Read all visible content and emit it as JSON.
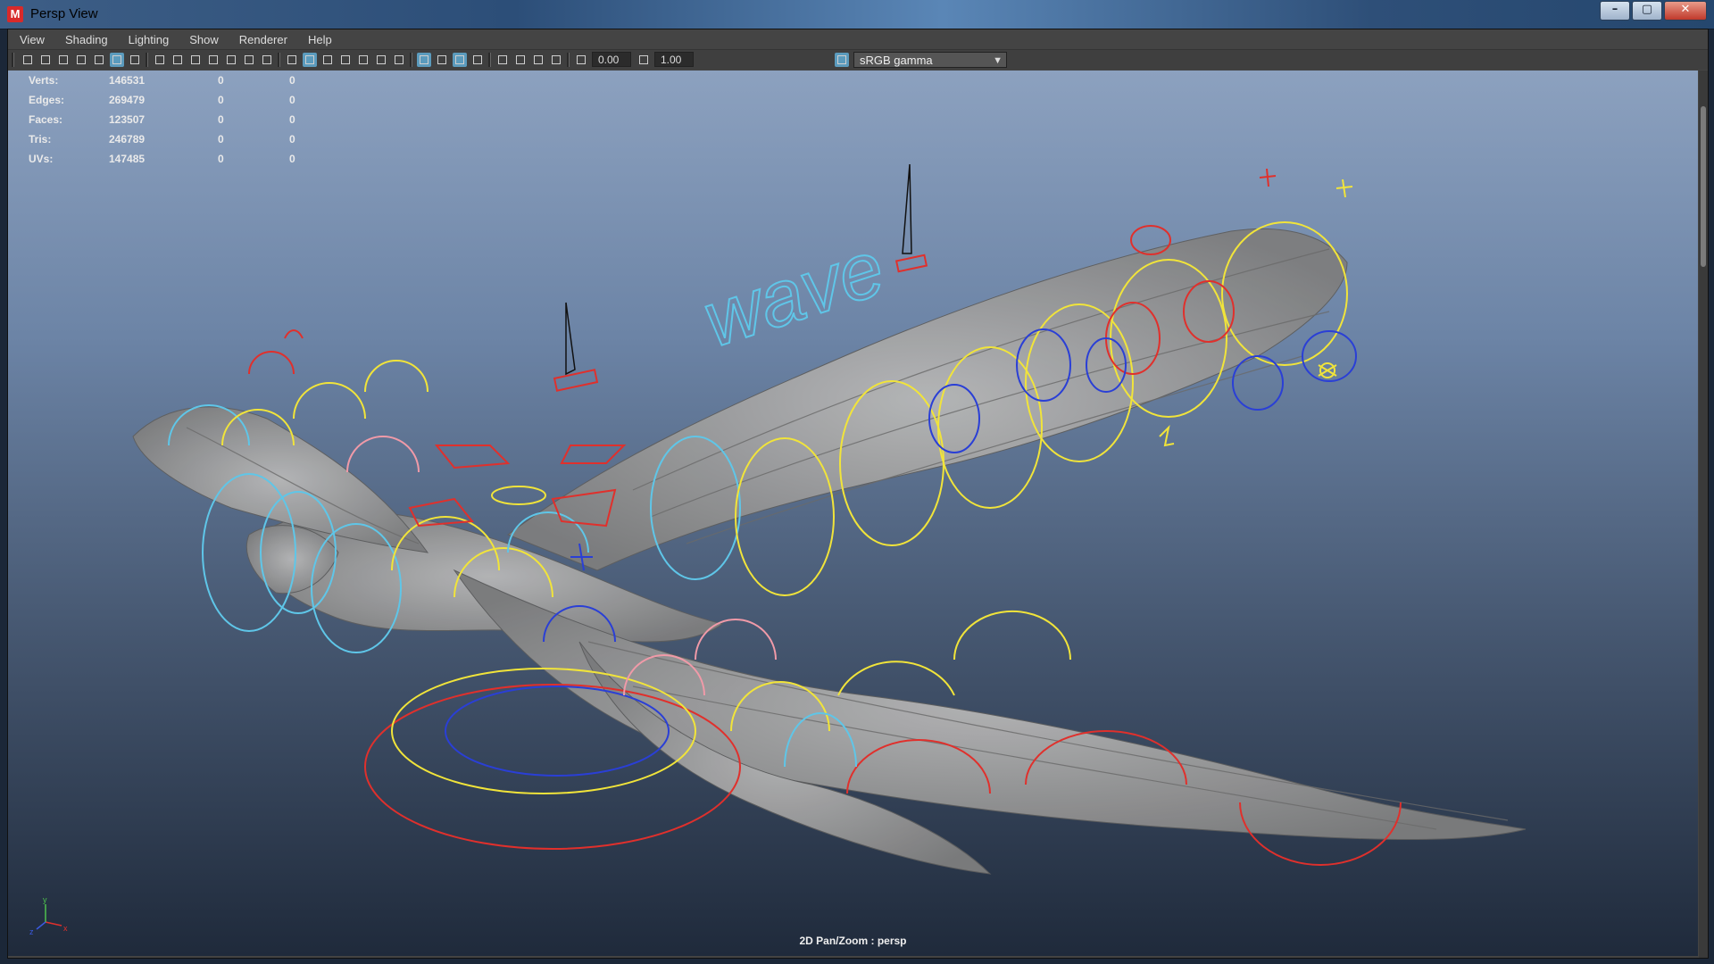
{
  "window": {
    "title": "Persp View",
    "app_icon_letter": "M",
    "controls": {
      "minimize": "–",
      "maximize": "▢",
      "close": "✕"
    }
  },
  "menu": {
    "items": [
      "View",
      "Shading",
      "Lighting",
      "Show",
      "Renderer",
      "Help"
    ]
  },
  "toolbar": {
    "exposure": "0.00",
    "gamma": "1.00",
    "color_space": "sRGB gamma",
    "active_color": "#5b9bbd"
  },
  "hud": {
    "rows": [
      {
        "label": "Verts:",
        "v1": "146531",
        "v2": "0",
        "v3": "0"
      },
      {
        "label": "Edges:",
        "v1": "269479",
        "v2": "0",
        "v3": "0"
      },
      {
        "label": "Faces:",
        "v1": "123507",
        "v2": "0",
        "v3": "0"
      },
      {
        "label": "Tris:",
        "v1": "246789",
        "v2": "0",
        "v3": "0"
      },
      {
        "label": "UVs:",
        "v1": "147485",
        "v2": "0",
        "v3": "0"
      }
    ]
  },
  "viewport": {
    "camera_label": "2D Pan/Zoom : persp",
    "control_text": "wave",
    "axis": {
      "x": "x",
      "y": "y",
      "z": "z"
    },
    "rig_colors": {
      "yellow": "#f1e43a",
      "cyan": "#5fc6e8",
      "red": "#e0302c",
      "blue": "#2a3fd6",
      "pink": "#f09aa8"
    },
    "model_color": "#9a9a9a"
  }
}
